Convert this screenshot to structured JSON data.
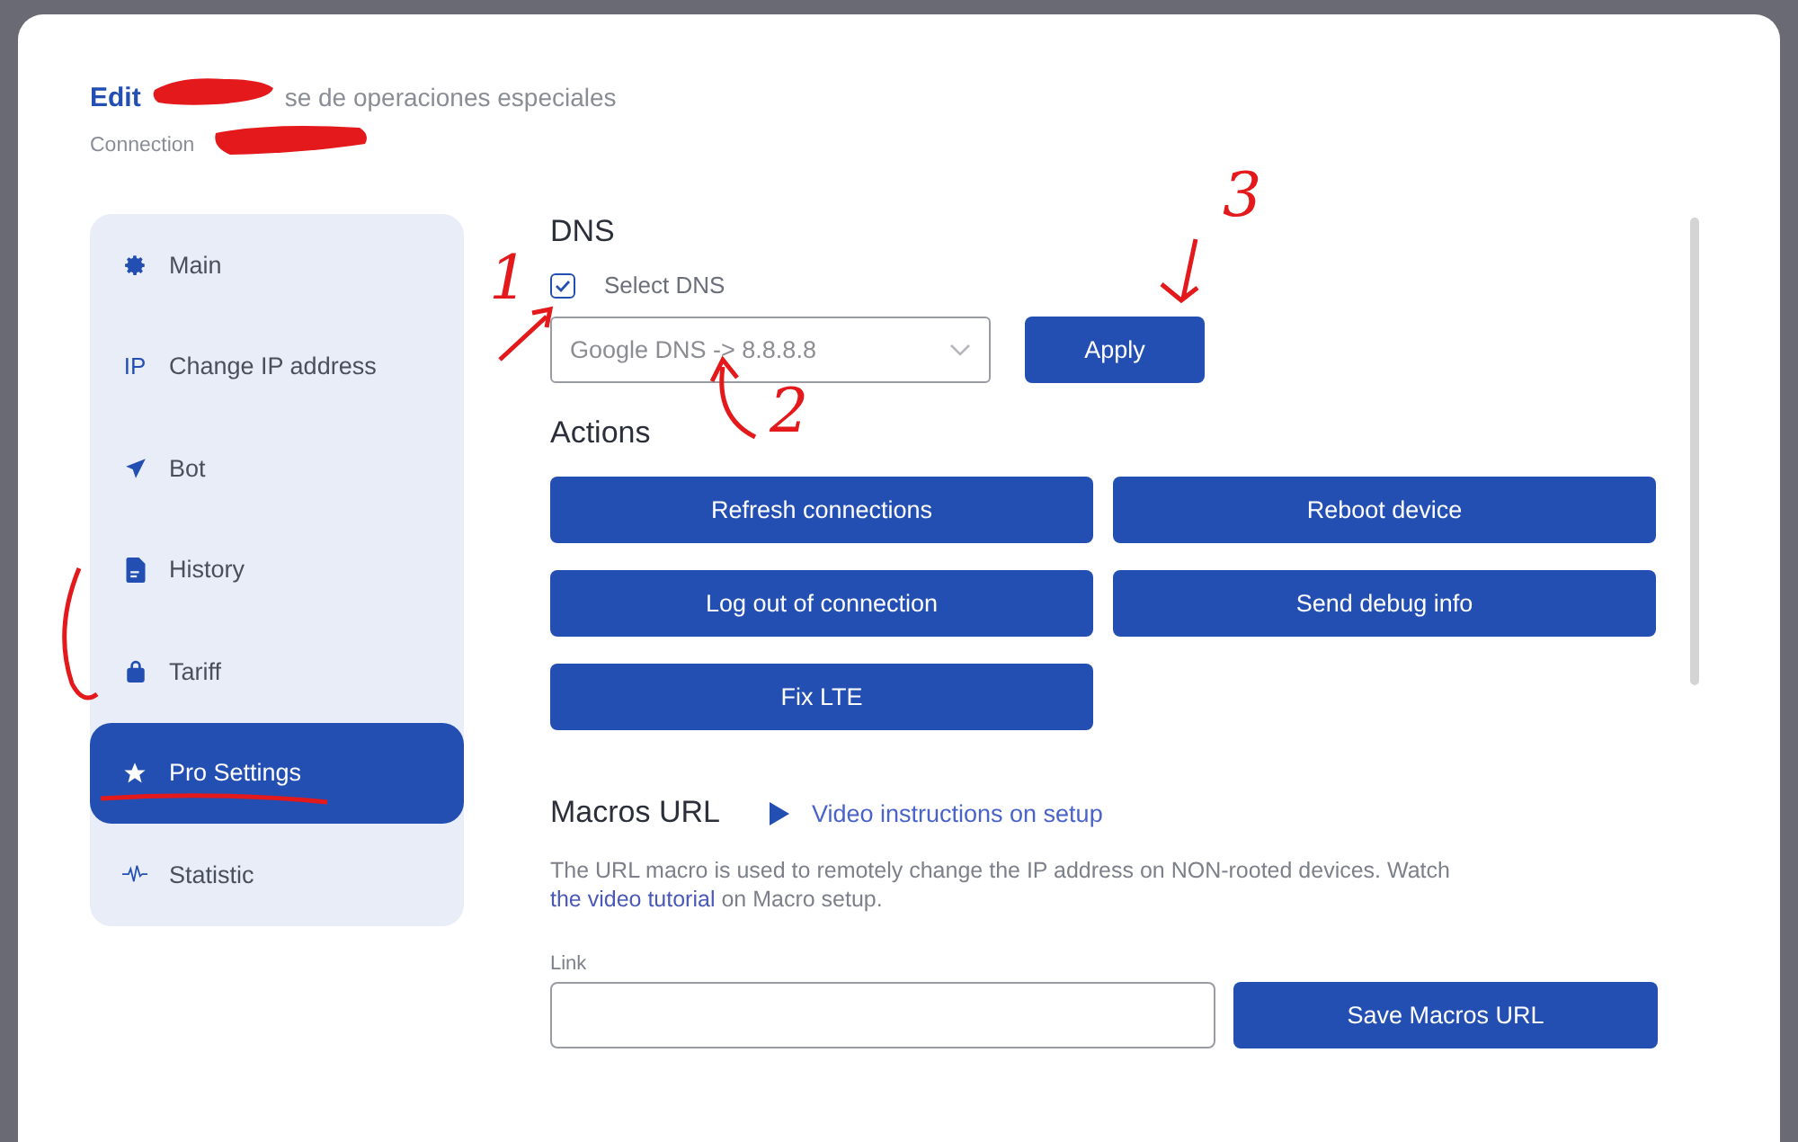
{
  "dialog": {
    "title": {
      "prefix": "Edit",
      "rest": "se de operaciones especiales"
    },
    "subtitle": "Connection"
  },
  "sidebar": {
    "items": [
      {
        "label": "Main",
        "selected": false
      },
      {
        "icon_text": "IP",
        "label": "Change IP address",
        "selected": false
      },
      {
        "label": "Bot",
        "selected": false
      },
      {
        "label": "History",
        "selected": false
      },
      {
        "label": "Tariff",
        "selected": false
      },
      {
        "label": "Pro Settings",
        "selected": true
      },
      {
        "label": "Statistic",
        "selected": false
      }
    ]
  },
  "dns": {
    "title": "DNS",
    "checkbox": {
      "label": "Select DNS",
      "checked": true
    },
    "select": {
      "value": "Google DNS -> 8.8.8.8"
    },
    "apply": "Apply"
  },
  "actions": {
    "title": "Actions",
    "buttons": [
      "Refresh connections",
      "Reboot device",
      "Log out of connection",
      "Send debug info",
      "Fix LTE"
    ]
  },
  "macros": {
    "title": "Macros URL",
    "video_link": "Video instructions on setup",
    "description": "The URL macro is used to remotely change the IP address on NON-rooted devices. Watch ",
    "description_link": "the video tutorial",
    "description_end": " on Macro setup.",
    "field_label": "Link",
    "save": "Save Macros URL"
  },
  "annotations": {
    "numbers": [
      "1",
      "2",
      "3"
    ]
  }
}
